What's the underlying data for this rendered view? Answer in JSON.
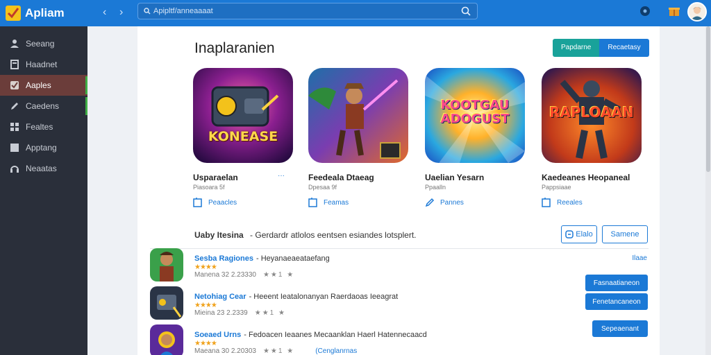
{
  "app": {
    "name": "Apliam"
  },
  "sidebar": {
    "items": [
      {
        "label": "Seeang"
      },
      {
        "label": "Haadnet"
      },
      {
        "label": "Aaples"
      },
      {
        "label": "Caedens"
      },
      {
        "label": "Fealtes"
      },
      {
        "label": "Apptang"
      },
      {
        "label": "Neaatas"
      }
    ]
  },
  "topbar": {
    "search_placeholder": "Apipltf/anneaaaat"
  },
  "main": {
    "title": "Inaplaranien",
    "segmented": [
      "Papdarne",
      "Recaetasy"
    ],
    "cards": [
      {
        "art_text": "KONEASE",
        "title": "Usparaelan",
        "sub": "Piasoara 5f",
        "link": "Peaacles"
      },
      {
        "art_text": "",
        "title": "Feedeala Dtaeag",
        "sub": "Dpesaa 9f",
        "link": "Feamas"
      },
      {
        "art_text": "KOOTGAU ADOGUST",
        "title": "Uaelian Yesarn",
        "sub": "Ppaalln",
        "link": "Pannes"
      },
      {
        "art_text": "RAPLOAAN",
        "title": "Kaedeanes Heopaneal",
        "sub": "Pappsiaae",
        "link": "Reeales"
      }
    ],
    "card_extra": "···",
    "section": {
      "title": "Uaby Itesina",
      "desc": "- Gerdardr atlolos eentsen esiandes lotsplert.",
      "btn1": "Elalo",
      "btn2": "Samene"
    },
    "rows": [
      {
        "name": "Sesba Ragiones",
        "desc": "- Heyanaeaeataefang",
        "stars": "★★★★",
        "meta": "Manena 32 2.23330",
        "rating": "★★1 ★",
        "extra": "",
        "link": "Ilaae",
        "button": ""
      },
      {
        "name": "Netohiag Cear",
        "desc": "- Heeent Ieatalonanyan Raerdaoas Ieeagrat",
        "stars": "★★★★",
        "meta": "Mieina 23 2.2339",
        "rating": "★★1 ★",
        "extra": "",
        "link": "",
        "button": "Fenetancaneon"
      },
      {
        "name": "Soeaed Urns",
        "desc": "- Fedoacen Ieaanes Mecaanklan Haerl Hatennecaacd",
        "stars": "★★★★",
        "meta": "Maeana 30 2.20303",
        "rating": "★★1 ★",
        "extra": "(Cenglanrnas",
        "link": "",
        "button": "Sepeaenant"
      }
    ],
    "row1_button": "Fasnaatianeon"
  },
  "colors": {
    "accent": "#1b79d6",
    "sidebar": "#2a2f3a",
    "teal": "#19a29a",
    "star": "#f0a21b"
  }
}
